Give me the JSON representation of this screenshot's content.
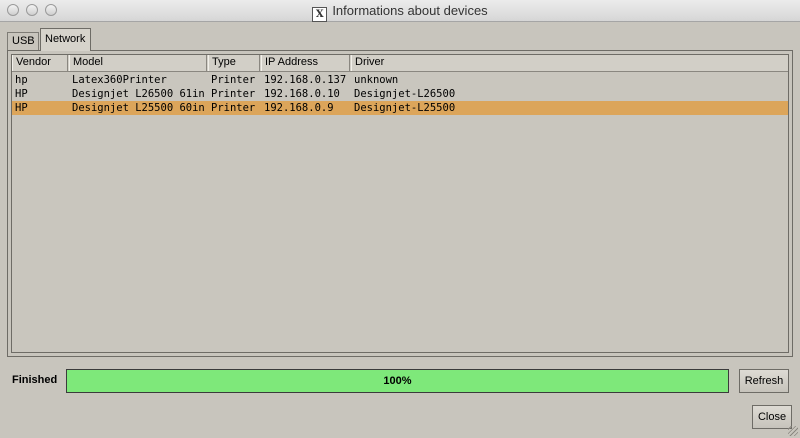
{
  "window": {
    "title": "Informations about devices",
    "icon": "x11-icon"
  },
  "tabs": [
    {
      "label": "USB",
      "active": false
    },
    {
      "label": "Network",
      "active": true
    }
  ],
  "table": {
    "columns": [
      "Vendor",
      "Model",
      "Type",
      "IP Address",
      "Driver"
    ],
    "rows": [
      {
        "vendor": "hp",
        "model": "Latex360Printer",
        "type": "Printer",
        "ip": "192.168.0.137",
        "driver": "unknown",
        "selected": false
      },
      {
        "vendor": "HP",
        "model": "Designjet L26500 61in",
        "type": "Printer",
        "ip": "192.168.0.10",
        "driver": "Designjet-L26500",
        "selected": false
      },
      {
        "vendor": "HP",
        "model": "Designjet L25500 60in",
        "type": "Printer",
        "ip": "192.168.0.9",
        "driver": "Designjet-L25500",
        "selected": true
      }
    ]
  },
  "status": {
    "label": "Finished",
    "progress": 1.0,
    "progress_text": "100%",
    "progress_color": "#7ee87a"
  },
  "buttons": {
    "refresh": "Refresh",
    "close": "Close"
  },
  "colors": {
    "selection": "#dca55a",
    "background": "#c8c5bd"
  }
}
